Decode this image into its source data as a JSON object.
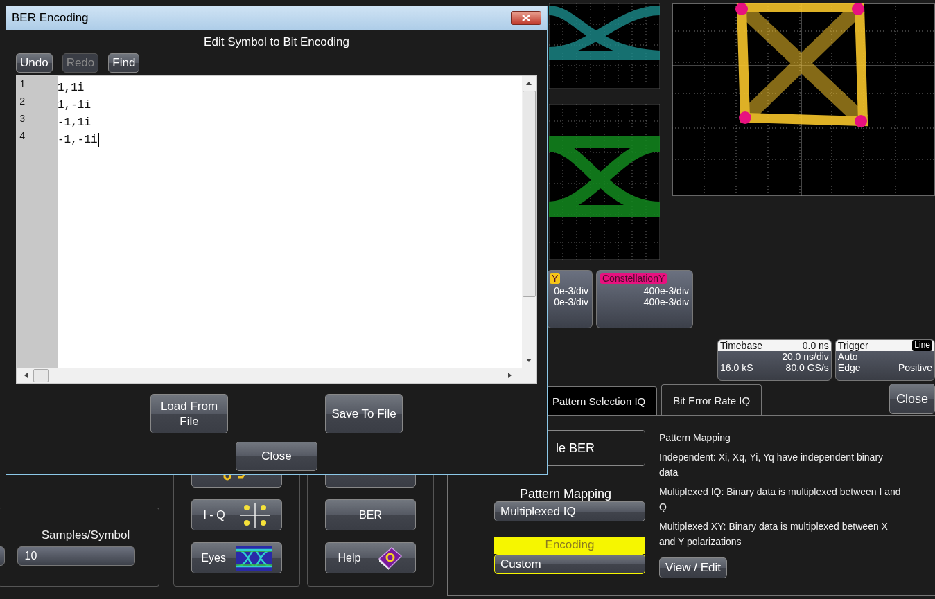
{
  "dialog": {
    "title": "BER Encoding",
    "heading": "Edit Symbol to Bit Encoding",
    "toolbar": [
      {
        "label": "Undo",
        "disabled": false
      },
      {
        "label": "Redo",
        "disabled": true
      },
      {
        "label": "Find",
        "disabled": false
      }
    ],
    "editor": {
      "lines": [
        {
          "number": "1",
          "text": "1,1i",
          "caret": false
        },
        {
          "number": "2",
          "text": "1,-1i",
          "caret": false
        },
        {
          "number": "3",
          "text": "-1,1i",
          "caret": false
        },
        {
          "number": "4",
          "text": "-1,-1i",
          "caret": true
        }
      ]
    },
    "file_buttons": [
      "Load From File",
      "Save To File"
    ],
    "close_button": "Close"
  },
  "trace_descriptors": [
    {
      "label": "Y",
      "color": "#f5c518",
      "values": [
        "0e-3/div",
        "0e-3/div"
      ]
    },
    {
      "label": "ConstellationY",
      "color": "#e8117f",
      "values": [
        "400e-3/div",
        "400e-3/div"
      ]
    }
  ],
  "timebase": {
    "label": "Timebase",
    "delay": "0.0 ns",
    "scale": "20.0 ns/div",
    "samples": "16.0 kS",
    "rate": "80.0 GS/s"
  },
  "trigger": {
    "label": "Trigger",
    "source": "Line",
    "mode": "Auto",
    "type": "Edge",
    "slope": "Positive"
  },
  "left_panel": {
    "samples_label": "Samples/Symbol",
    "samples_value": "10",
    "button_columns": [
      [
        {
          "kind": "traces"
        },
        {
          "label": "I - Q",
          "kind": "iq"
        },
        {
          "label": "Eyes",
          "kind": "eye"
        }
      ],
      [
        {
          "kind": "plain"
        },
        {
          "label": "BER",
          "kind": "plain"
        },
        {
          "label": "Help",
          "kind": "help"
        }
      ]
    ]
  },
  "tabs": [
    {
      "label": "Pattern Selection IQ",
      "selected": false
    },
    {
      "label": "Bit Error Rate IQ",
      "selected": true
    }
  ],
  "close_button": "Close",
  "ber_panel": {
    "enable_button": "le BER",
    "pattern_mapping": {
      "label": "Pattern Mapping",
      "value": "Multiplexed IQ"
    },
    "encoding": {
      "label": "Encoding",
      "value": "Custom"
    },
    "help": {
      "title": "Pattern Mapping",
      "paragraphs": [
        "Independent: Xi, Xq, Yi, Yq have independent binary data",
        "Multiplexed IQ: Binary data is multiplexed between I and Q",
        "Multiplexed XY: Binary data is multiplexed between X and Y polarizations"
      ]
    },
    "view_edit_button": "View / Edit"
  }
}
